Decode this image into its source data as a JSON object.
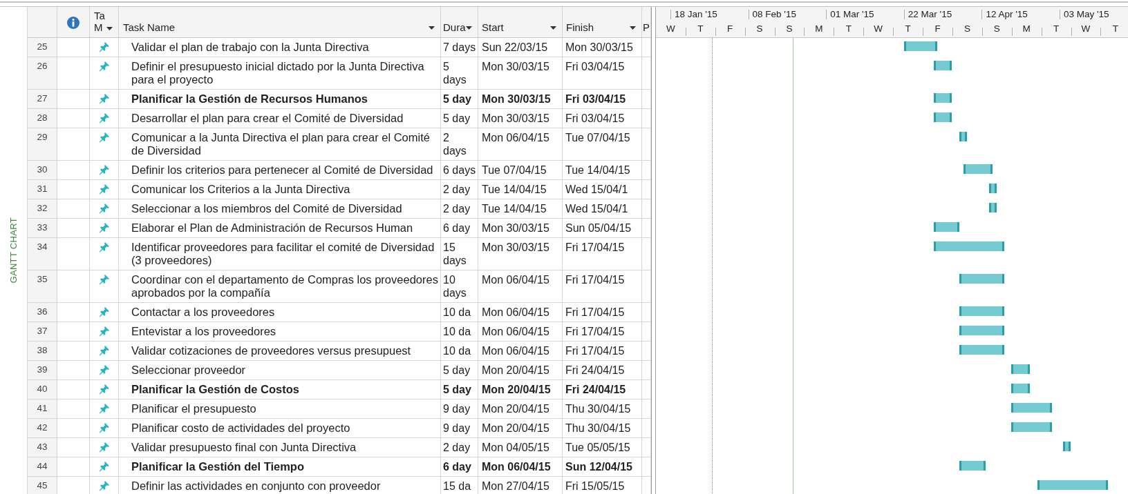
{
  "side_label": "GANTT CHART",
  "columns": {
    "task_mode": [
      "Ta",
      "M"
    ],
    "task_name": "Task Name",
    "duration": "Dura",
    "start": "Start",
    "finish": "Finish",
    "column_8": "P"
  },
  "timeline": {
    "major": [
      "18 Jan '15",
      "08 Feb '15",
      "01 Mar '15",
      "22 Mar '15",
      "12 Apr '15",
      "03 May '15"
    ],
    "minor": [
      "W",
      "T",
      "F",
      "S",
      "S",
      "M",
      "T",
      "W",
      "T",
      "F",
      "S",
      "S",
      "M",
      "T",
      "W",
      "T"
    ]
  },
  "rows": [
    {
      "id": "25",
      "name": "Validar el plan de trabajo con la Junta Directiva",
      "duration": "7 days",
      "start": "Sun 22/03/15",
      "finish": "Mon 30/03/15",
      "summary": false
    },
    {
      "id": "26",
      "name": "Definir el presupuesto inicial dictado por la Junta Directiva para el proyecto",
      "duration": "5 days",
      "start": "Mon 30/03/15",
      "finish": "Fri 03/04/15",
      "summary": false
    },
    {
      "id": "27",
      "name": "Planificar la Gestión de Recursos Humanos",
      "duration": "5 day",
      "start": "Mon 30/03/15",
      "finish": "Fri 03/04/15",
      "summary": true
    },
    {
      "id": "28",
      "name": "Desarrollar el plan para crear el Comité de Diversidad",
      "duration": "5 day",
      "start": "Mon 30/03/15",
      "finish": "Fri 03/04/15",
      "summary": false
    },
    {
      "id": "29",
      "name": "Comunicar a la Junta Directiva el plan para crear el Comité de Diversidad",
      "duration": "2 days",
      "start": "Mon 06/04/15",
      "finish": "Tue 07/04/15",
      "summary": false
    },
    {
      "id": "30",
      "name": "Definir los criterios para pertenecer al Comité de Diversidad",
      "duration": "6 days",
      "start": "Tue 07/04/15",
      "finish": "Tue 14/04/15",
      "summary": false
    },
    {
      "id": "31",
      "name": "Comunicar los Criterios a la Junta Directiva",
      "duration": "2 day",
      "start": "Tue 14/04/15",
      "finish": "Wed 15/04/1",
      "summary": false
    },
    {
      "id": "32",
      "name": "Seleccionar a los miembros del Comité de Diversidad",
      "duration": "2 day",
      "start": "Tue 14/04/15",
      "finish": "Wed 15/04/1",
      "summary": false
    },
    {
      "id": "33",
      "name": "Elaborar el Plan de Administración de Recursos Human",
      "duration": "6 day",
      "start": "Mon 30/03/15",
      "finish": "Sun 05/04/15",
      "summary": false
    },
    {
      "id": "34",
      "name": "Identificar proveedores para facilitar el comité de Diversidad (3 proveedores)",
      "duration": "15 days",
      "start": "Mon 30/03/15",
      "finish": "Fri 17/04/15",
      "summary": false
    },
    {
      "id": "35",
      "name": "Coordinar con el departamento de Compras los proveedores aprobados por la compañía",
      "duration": "10 days",
      "start": "Mon 06/04/15",
      "finish": "Fri 17/04/15",
      "summary": false
    },
    {
      "id": "36",
      "name": "Contactar a los proveedores",
      "duration": "10 da",
      "start": "Mon 06/04/15",
      "finish": "Fri 17/04/15",
      "summary": false
    },
    {
      "id": "37",
      "name": "Entevistar a los proveedores",
      "duration": "10 da",
      "start": "Mon 06/04/15",
      "finish": "Fri 17/04/15",
      "summary": false
    },
    {
      "id": "38",
      "name": "Validar cotizaciones de proveedores versus presupuest",
      "duration": "10 da",
      "start": "Mon 06/04/15",
      "finish": "Fri 17/04/15",
      "summary": false
    },
    {
      "id": "39",
      "name": "Seleccionar proveedor",
      "duration": "5 day",
      "start": "Mon 20/04/15",
      "finish": "Fri 24/04/15",
      "summary": false
    },
    {
      "id": "40",
      "name": "Planificar la Gestión de Costos",
      "duration": "5 day",
      "start": "Mon 20/04/15",
      "finish": "Fri 24/04/15",
      "summary": true
    },
    {
      "id": "41",
      "name": "Planificar el presupuesto",
      "duration": "9 day",
      "start": "Mon 20/04/15",
      "finish": "Thu 30/04/15",
      "summary": false
    },
    {
      "id": "42",
      "name": "Planificar costo de actividades del proyecto",
      "duration": "9 day",
      "start": "Mon 20/04/15",
      "finish": "Thu 30/04/15",
      "summary": false
    },
    {
      "id": "43",
      "name": "Validar presupuesto final con Junta Directiva",
      "duration": "2 day",
      "start": "Mon 04/05/15",
      "finish": "Tue 05/05/15",
      "summary": false
    },
    {
      "id": "44",
      "name": "Planificar la Gestión del Tiempo",
      "duration": "6 day",
      "start": "Mon 06/04/15",
      "finish": "Sun 12/04/15",
      "summary": true
    },
    {
      "id": "45",
      "name": "Definir las actividades en conjunto con proveedor",
      "duration": "15 da",
      "start": "Mon 27/04/15",
      "finish": "Fri 15/05/15",
      "summary": false
    }
  ]
}
